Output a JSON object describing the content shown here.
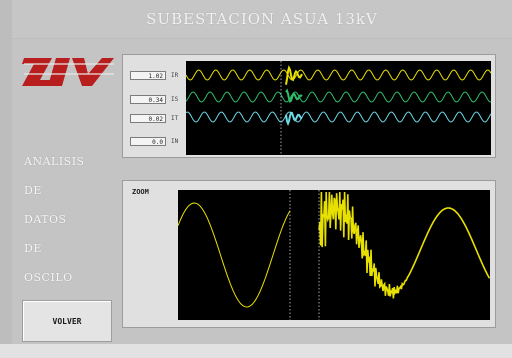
{
  "title": "SUBESTACION   ASUA   13kV",
  "logo": {
    "text": "ZIV",
    "color": "#b81e1e"
  },
  "menu": [
    "ANALISIS",
    "DE",
    "DATOS",
    "DE",
    "OSCILO"
  ],
  "buttons": {
    "back": "VOLVER"
  },
  "channels": [
    {
      "value": "1.02",
      "tag": "IR",
      "color": "#e8e000"
    },
    {
      "value": "0.34",
      "tag": "IS",
      "color": "#2fbf6a"
    },
    {
      "value": "0.02",
      "tag": "IT",
      "color": "#6fd8e6"
    },
    {
      "value": "0.0",
      "tag": "IN",
      "color": "#b0b0b0"
    }
  ],
  "zoom": {
    "label": "ZOOM",
    "trace_color": "#e8e000"
  },
  "colors": {
    "scope_bg": "#000000",
    "cursor": "#cfcfcf"
  }
}
